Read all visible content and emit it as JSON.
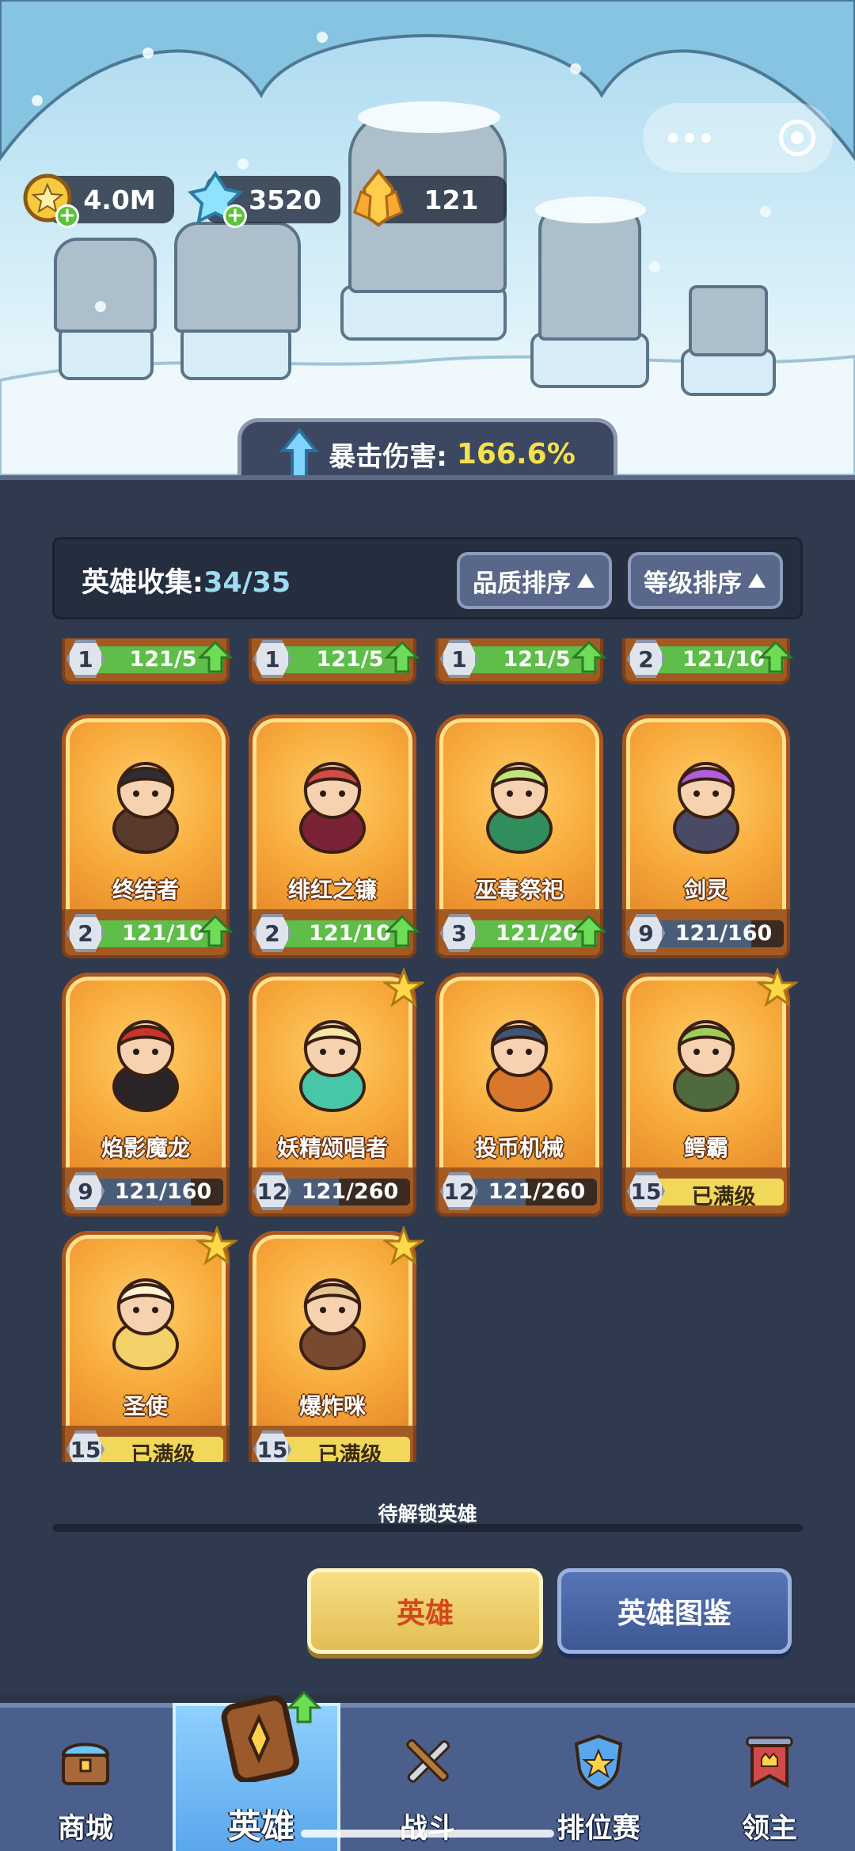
{
  "currencies": {
    "gold": {
      "value": "4.0M",
      "icon": "gold-coin-icon"
    },
    "crystal": {
      "value": "3520",
      "icon": "blue-crystal-icon"
    },
    "gem": {
      "value": "121",
      "icon": "gold-gem-icon"
    }
  },
  "crit_banner": {
    "label": "暴击伤害:",
    "value": "166.6%"
  },
  "collection": {
    "label": "英雄收集:",
    "count": "34/35"
  },
  "sort": {
    "quality": "品质排序",
    "level": "等级排序"
  },
  "partial_row": [
    {
      "level": "1",
      "progress": "121/5",
      "fill": 1.0,
      "can_upgrade": true
    },
    {
      "level": "1",
      "progress": "121/5",
      "fill": 1.0,
      "can_upgrade": true
    },
    {
      "level": "1",
      "progress": "121/5",
      "fill": 1.0,
      "can_upgrade": true
    },
    {
      "level": "2",
      "progress": "121/10",
      "fill": 1.0,
      "can_upgrade": true
    }
  ],
  "heroes": [
    {
      "name": "终结者",
      "level": "2",
      "progress": "121/10",
      "fill": 1.0,
      "can_upgrade": true,
      "starred": false,
      "icon": "terminator-hero-icon"
    },
    {
      "name": "绯红之镰",
      "level": "2",
      "progress": "121/10",
      "fill": 1.0,
      "can_upgrade": true,
      "starred": false,
      "icon": "crimson-scythe-hero-icon"
    },
    {
      "name": "巫毒祭祀",
      "level": "3",
      "progress": "121/20",
      "fill": 1.0,
      "can_upgrade": true,
      "starred": false,
      "icon": "voodoo-priest-hero-icon"
    },
    {
      "name": "剑灵",
      "level": "9",
      "progress": "121/160",
      "fill": 0.75,
      "can_upgrade": false,
      "starred": false,
      "icon": "sword-spirit-hero-icon"
    },
    {
      "name": "焰影魔龙",
      "level": "9",
      "progress": "121/160",
      "fill": 0.75,
      "can_upgrade": false,
      "starred": false,
      "icon": "shadow-dragon-hero-icon"
    },
    {
      "name": "妖精颂唱者",
      "level": "12",
      "progress": "121/260",
      "fill": 0.46,
      "can_upgrade": false,
      "starred": true,
      "icon": "fairy-singer-hero-icon"
    },
    {
      "name": "投币机械",
      "level": "12",
      "progress": "121/260",
      "fill": 0.46,
      "can_upgrade": false,
      "starred": false,
      "icon": "slot-machine-hero-icon"
    },
    {
      "name": "鳄霸",
      "level": "15",
      "progress": "已满级",
      "fill": 1.0,
      "can_upgrade": false,
      "starred": true,
      "maxed": true,
      "icon": "croc-boss-hero-icon"
    },
    {
      "name": "圣使",
      "level": "15",
      "progress": "已满级",
      "fill": 1.0,
      "can_upgrade": false,
      "starred": true,
      "maxed": true,
      "icon": "angel-hero-icon"
    },
    {
      "name": "爆炸咪",
      "level": "15",
      "progress": "已满级",
      "fill": 1.0,
      "can_upgrade": false,
      "starred": true,
      "maxed": true,
      "icon": "boom-cat-hero-icon"
    }
  ],
  "unlock": {
    "title": "待解锁英雄"
  },
  "tabs": {
    "heroes": "英雄",
    "codex": "英雄图鉴"
  },
  "nav": [
    {
      "label": "商城",
      "icon": "shop-chest-icon",
      "active": false
    },
    {
      "label": "英雄",
      "icon": "hero-card-icon",
      "active": true
    },
    {
      "label": "战斗",
      "icon": "crossed-weapons-icon",
      "active": false
    },
    {
      "label": "排位赛",
      "icon": "rank-shield-icon",
      "active": false
    },
    {
      "label": "领主",
      "icon": "lord-banner-icon",
      "active": false
    }
  ]
}
